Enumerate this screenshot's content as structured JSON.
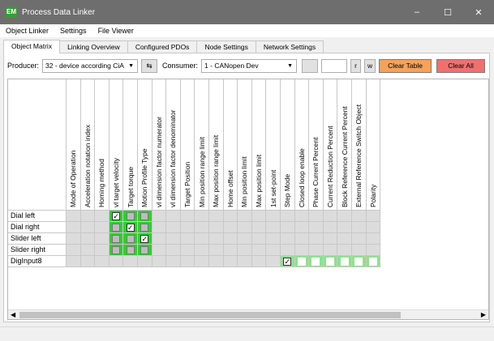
{
  "window": {
    "icon": "EM",
    "title": "Process Data Linker",
    "minimize": "–",
    "maximize": "☐",
    "close": "✕"
  },
  "menu": [
    "Object Linker",
    "Settings",
    "File Viewer"
  ],
  "tabs": [
    {
      "label": "Object Matrix",
      "active": true
    },
    {
      "label": "Linking Overview",
      "active": false
    },
    {
      "label": "Configured PDOs",
      "active": false
    },
    {
      "label": "Node Settings",
      "active": false
    },
    {
      "label": "Network Settings",
      "active": false
    }
  ],
  "toolbar": {
    "producer_label": "Producer:",
    "producer_value": "32 - device according CiA",
    "swap_icon": "⇆",
    "consumer_label": "Consumer:",
    "consumer_value": "1 - CANopen Dev",
    "r_label": "r",
    "w_label": "w",
    "clear_table": "Clear Table",
    "clear_all": "Clear All",
    "clear_table_color": "#f5a25a",
    "clear_all_color": "#f07070"
  },
  "matrix": {
    "columns": [
      "Mode of Operation",
      "Acceleration notation index",
      "Homing method",
      "vl target velocity",
      "Target torque",
      "Motion Profile Type",
      "vl dimension factor numerator",
      "vl dimension factor denominator",
      "Target Position",
      "Min position range limit",
      "Max position range limit",
      "Home offset",
      "Min position limit",
      "Max position limit",
      "1st set-point",
      "Step Mode",
      "Closed loop enable",
      "Phase Current Percent",
      "Current Reduction Percent",
      "Block Reference Current Percent",
      "External Reference Switch Object",
      "Polarity"
    ],
    "rows": [
      {
        "label": "Dial left",
        "cells": [
          "g",
          "g",
          "g",
          "c1",
          "c0",
          "c0",
          "g",
          "g",
          "g",
          "g",
          "g",
          "g",
          "g",
          "g",
          "g",
          "g",
          "g",
          "g",
          "g",
          "g",
          "g",
          "g"
        ]
      },
      {
        "label": "Dial right",
        "cells": [
          "g",
          "g",
          "g",
          "c0",
          "c1",
          "c0",
          "g",
          "g",
          "g",
          "g",
          "g",
          "g",
          "g",
          "g",
          "g",
          "g",
          "g",
          "g",
          "g",
          "g",
          "g",
          "g"
        ]
      },
      {
        "label": "Slider left",
        "cells": [
          "g",
          "g",
          "g",
          "c0",
          "c0",
          "c1",
          "g",
          "g",
          "g",
          "g",
          "g",
          "g",
          "g",
          "g",
          "g",
          "g",
          "g",
          "g",
          "g",
          "g",
          "g",
          "g"
        ]
      },
      {
        "label": "Slider right",
        "cells": [
          "g",
          "g",
          "g",
          "c0",
          "c0",
          "c0",
          "g",
          "g",
          "g",
          "g",
          "g",
          "g",
          "g",
          "g",
          "g",
          "g",
          "g",
          "g",
          "g",
          "g",
          "g",
          "g"
        ]
      },
      {
        "label": "DigInput8",
        "cells": [
          "g",
          "g",
          "g",
          "g",
          "g",
          "g",
          "g",
          "g",
          "g",
          "g",
          "g",
          "g",
          "g",
          "g",
          "g",
          "d1",
          "d0",
          "d0",
          "d0",
          "d0",
          "d0",
          "d0"
        ]
      }
    ],
    "check_mark": "✓"
  },
  "scroll": {
    "left": "◀",
    "right": "▶"
  }
}
